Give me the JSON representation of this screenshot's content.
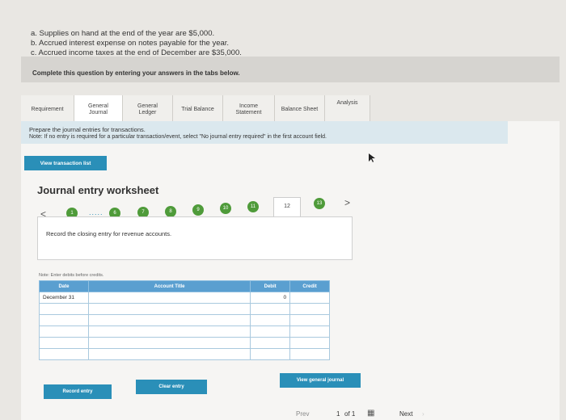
{
  "intro": {
    "line_a": "a. Supplies on hand at the end of the year are $5,000.",
    "line_b": "b. Accrued interest expense on notes payable for the year.",
    "line_c": "c. Accrued income taxes at the end of December are $35,000."
  },
  "complete_prompt": "Complete this question by entering your answers in the tabs below.",
  "tabs": [
    {
      "label": "Requirement"
    },
    {
      "label": "General Journal"
    },
    {
      "label": "General Ledger"
    },
    {
      "label": "Trial Balance"
    },
    {
      "label": "Income Statement"
    },
    {
      "label": "Balance Sheet"
    },
    {
      "label": "Analysis"
    }
  ],
  "instructions": {
    "line1": "Prepare the journal entries for transactions.",
    "line2": "Note: If no entry is required for a particular transaction/event, select \"No journal entry required\" in the first account field."
  },
  "view_transaction_button": "View transaction list",
  "worksheet": {
    "title": "Journal entry worksheet",
    "prev_arrow": "<",
    "next_arrow": ">",
    "dots": ".....",
    "steps": [
      "1",
      "6",
      "7",
      "8",
      "9",
      "10",
      "11",
      "12",
      "13"
    ],
    "current_step": "12",
    "record_prompt": "Record the closing entry for revenue accounts."
  },
  "note_text": "Note: Enter debits before credits.",
  "table": {
    "headers": {
      "date": "Date",
      "account": "Account Title",
      "debit": "Debit",
      "credit": "Credit"
    },
    "rows": [
      {
        "date": "December 31",
        "account": "",
        "debit": "0",
        "credit": ""
      },
      {
        "date": "",
        "account": "",
        "debit": "",
        "credit": ""
      },
      {
        "date": "",
        "account": "",
        "debit": "",
        "credit": ""
      },
      {
        "date": "",
        "account": "",
        "debit": "",
        "credit": ""
      },
      {
        "date": "",
        "account": "",
        "debit": "",
        "credit": ""
      },
      {
        "date": "",
        "account": "",
        "debit": "",
        "credit": ""
      }
    ]
  },
  "buttons": {
    "record": "Record entry",
    "clear": "Clear entry",
    "view_general": "View general journal"
  },
  "pager": {
    "prev": "Prev",
    "page": "1",
    "of": "of 1",
    "next": "Next"
  },
  "colors": {
    "accent": "#2a8fb8",
    "step_done": "#4f9b3a",
    "table_header": "#5a9fd0"
  }
}
